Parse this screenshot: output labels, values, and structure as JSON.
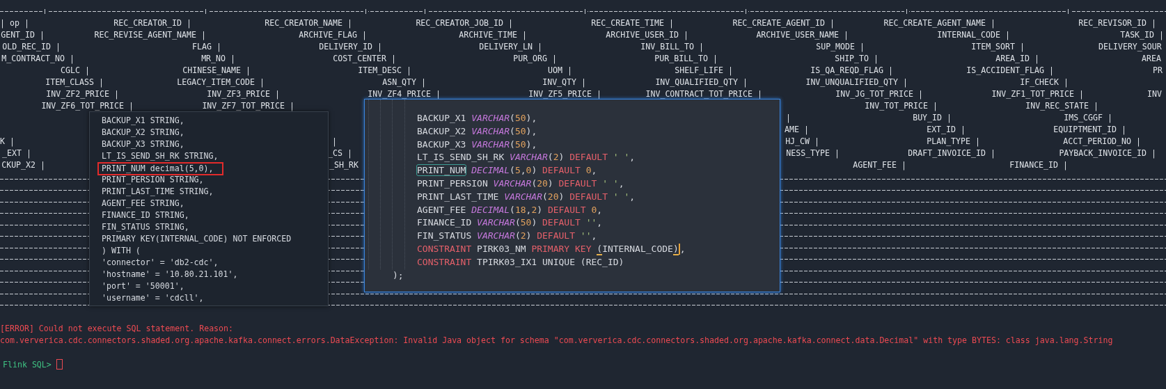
{
  "terminal": {
    "header_rows": [
      [
        "| op |",
        "REC_CREATOR_ID |",
        "REC_CREATOR_NAME |",
        "REC_CREATOR_JOB_ID |",
        "REC_CREATE_TIME |",
        "REC_CREATE_AGENT_ID |",
        "REC_CREATE_AGENT_NAME |",
        "REC_REVISOR_ID |"
      ],
      [
        "GENT_ID |",
        "REC_REVISE_AGENT_NAME |",
        "ARCHIVE_FLAG |",
        "ARCHIVE_TIME |",
        "ARCHIVE_USER_ID |",
        "ARCHIVE_USER_NAME |",
        "INTERNAL_CODE |",
        "TASK_ID |"
      ],
      [
        "OLD_REC_ID |",
        "FLAG |",
        "DELIVERY_ID |",
        "DELIVERY_LN |",
        "INV_BILL_TO |",
        "SUP_MODE |",
        "ITEM_SORT |",
        "DELIVERY_SOUR"
      ],
      [
        "M_CONTRACT_NO |",
        "MR_NO |",
        "COST_CENTER |",
        "PUR_ORG |",
        "PUR_BILL_TO |",
        "SHIP_TO |",
        "AREA_ID |",
        "AREA"
      ],
      [
        "CGLC |",
        "CHINESE_NAME |",
        "ITEM_DESC |",
        "UOM |",
        "SHELF_LIFE |",
        "IS_QA_REQD_FLAG |",
        "IS_ACCIDENT_FLAG |",
        "PR"
      ],
      [
        "ITEM_CLASS |",
        "LEGACY_ITEM_CODE |",
        "ASN_QTY |",
        "INV_QTY |",
        "INV_QUALIFIED_QTY |",
        "INV_UNQUALIFIED_QTY |",
        "IF_CHECK |"
      ],
      [
        "INV_ZF2_PRICE |",
        "INV_ZF3_PRICE |",
        "INV_ZF4_PRICE |",
        "INV_ZF5_PRICE |",
        "INV_CONTRACT_TOT_PRICE |",
        "INV_JG_TOT_PRICE |",
        "INV_ZF1_TOT_PRICE |",
        "INV"
      ],
      [
        "INV_ZF6_TOT_PRICE |",
        "INV_ZF7_TOT_PRICE |",
        "INV_TOT_PRICE |",
        "INV_REC_STATE |"
      ],
      [
        "|",
        "BUY_ID |",
        "IMS_CGGF |"
      ],
      [
        "AME |",
        "EXT_ID |",
        "EQUIPTMENT_ID |"
      ],
      [
        "K |",
        "|",
        "HJ_CW |",
        "PLAN_TYPE |",
        "ACCT_PERIOD_NO |"
      ],
      [
        "_EXT |",
        "_CS |",
        "NESS_TYPE |",
        "DRAFT_INVOICE_ID |",
        "PAYBACK_INVOICE_ID |"
      ],
      [
        "CKUP_X2 |",
        "_SH_RK",
        "AGENT_FEE |",
        "FINANCE_ID |"
      ]
    ],
    "error_lines": [
      "[ERROR] Could not execute SQL statement. Reason:",
      "com.ververica.cdc.connectors.shaded.org.apache.kafka.connect.errors.DataException: Invalid Java object for schema \"com.ververica.cdc.connectors.shaded.org.apache.kafka.connect.data.Decimal\" with type BYTES: class java.lang.String"
    ],
    "prompt": "Flink SQL>"
  },
  "left_snippet": {
    "lines": [
      {
        "text": "BACKUP_X1 STRING,",
        "highlighted": false
      },
      {
        "text": "BACKUP_X2 STRING,",
        "highlighted": false
      },
      {
        "text": "BACKUP_X3 STRING,",
        "highlighted": false
      },
      {
        "text": "LT_IS_SEND_SH_RK STRING,",
        "highlighted": false
      },
      {
        "text": "PRINT_NUM decimal(5,0),",
        "highlighted": true
      },
      {
        "text": "PRINT_PERSION STRING,",
        "highlighted": false
      },
      {
        "text": "PRINT_LAST_TIME STRING,",
        "highlighted": false
      },
      {
        "text": "AGENT_FEE STRING,",
        "highlighted": false
      },
      {
        "text": "FINANCE_ID STRING,",
        "highlighted": false
      },
      {
        "text": "FIN_STATUS STRING,",
        "highlighted": false
      },
      {
        "text": "PRIMARY KEY(INTERNAL_CODE) NOT ENFORCED",
        "highlighted": false
      },
      {
        "text": ") WITH (",
        "highlighted": false
      },
      {
        "text": "'connector' = 'db2-cdc',",
        "highlighted": false
      },
      {
        "text": "'hostname' = '10.80.21.101',",
        "highlighted": false
      },
      {
        "text": "'port' = '50001',",
        "highlighted": false
      },
      {
        "text": "'username' = 'cdcll',",
        "highlighted": false
      }
    ]
  },
  "right_snippet": {
    "lines": [
      {
        "tokens": [
          {
            "text": "BACKUP_X1 ",
            "kind": "plain"
          },
          {
            "text": "VARCHAR",
            "kind": "type"
          },
          {
            "text": "(",
            "kind": "plain"
          },
          {
            "text": "50",
            "kind": "num"
          },
          {
            "text": "),",
            "kind": "plain"
          }
        ]
      },
      {
        "tokens": [
          {
            "text": "BACKUP_X2 ",
            "kind": "plain"
          },
          {
            "text": "VARCHAR",
            "kind": "type"
          },
          {
            "text": "(",
            "kind": "plain"
          },
          {
            "text": "50",
            "kind": "num"
          },
          {
            "text": "),",
            "kind": "plain"
          }
        ]
      },
      {
        "tokens": [
          {
            "text": "BACKUP_X3 ",
            "kind": "plain"
          },
          {
            "text": "VARCHAR",
            "kind": "type"
          },
          {
            "text": "(",
            "kind": "plain"
          },
          {
            "text": "50",
            "kind": "num"
          },
          {
            "text": "),",
            "kind": "plain"
          }
        ]
      },
      {
        "tokens": [
          {
            "text": "LT_IS_SEND_SH_RK ",
            "kind": "plain"
          },
          {
            "text": "VARCHAR",
            "kind": "type"
          },
          {
            "text": "(",
            "kind": "plain"
          },
          {
            "text": "2",
            "kind": "num"
          },
          {
            "text": ") ",
            "kind": "plain"
          },
          {
            "text": "DEFAULT ",
            "kind": "kw"
          },
          {
            "text": "' '",
            "kind": "str"
          },
          {
            "text": ",",
            "kind": "plain"
          }
        ]
      },
      {
        "tokens": [
          {
            "text": "PRINT_NUM",
            "kind": "boxed"
          },
          {
            "text": " DECIMAL",
            "kind": "type"
          },
          {
            "text": "(",
            "kind": "plain"
          },
          {
            "text": "5",
            "kind": "num"
          },
          {
            "text": ",",
            "kind": "plain"
          },
          {
            "text": "0",
            "kind": "num"
          },
          {
            "text": ") ",
            "kind": "plain"
          },
          {
            "text": "DEFAULT ",
            "kind": "kw"
          },
          {
            "text": "0",
            "kind": "num"
          },
          {
            "text": ",",
            "kind": "plain"
          }
        ]
      },
      {
        "tokens": [
          {
            "text": "PRINT_PERSION ",
            "kind": "plain"
          },
          {
            "text": "VARCHAR",
            "kind": "type"
          },
          {
            "text": "(",
            "kind": "plain"
          },
          {
            "text": "20",
            "kind": "num"
          },
          {
            "text": ") ",
            "kind": "plain"
          },
          {
            "text": "DEFAULT ",
            "kind": "kw"
          },
          {
            "text": "' '",
            "kind": "str"
          },
          {
            "text": ",",
            "kind": "plain"
          }
        ]
      },
      {
        "tokens": [
          {
            "text": "PRINT_LAST_TIME ",
            "kind": "plain"
          },
          {
            "text": "VARCHAR",
            "kind": "type"
          },
          {
            "text": "(",
            "kind": "plain"
          },
          {
            "text": "20",
            "kind": "num"
          },
          {
            "text": ") ",
            "kind": "plain"
          },
          {
            "text": "DEFAULT ",
            "kind": "kw"
          },
          {
            "text": "' '",
            "kind": "str"
          },
          {
            "text": ",",
            "kind": "plain"
          }
        ]
      },
      {
        "tokens": [
          {
            "text": "AGENT_FEE ",
            "kind": "plain"
          },
          {
            "text": "DECIMAL",
            "kind": "type"
          },
          {
            "text": "(",
            "kind": "plain"
          },
          {
            "text": "18",
            "kind": "num"
          },
          {
            "text": ",",
            "kind": "plain"
          },
          {
            "text": "2",
            "kind": "num"
          },
          {
            "text": ") ",
            "kind": "plain"
          },
          {
            "text": "DEFAULT ",
            "kind": "kw"
          },
          {
            "text": "0",
            "kind": "num"
          },
          {
            "text": ",",
            "kind": "plain"
          }
        ]
      },
      {
        "tokens": [
          {
            "text": "FINANCE_ID ",
            "kind": "plain"
          },
          {
            "text": "VARCHAR",
            "kind": "type"
          },
          {
            "text": "(",
            "kind": "plain"
          },
          {
            "text": "50",
            "kind": "num"
          },
          {
            "text": ") ",
            "kind": "plain"
          },
          {
            "text": "DEFAULT ",
            "kind": "kw"
          },
          {
            "text": "''",
            "kind": "str"
          },
          {
            "text": ",",
            "kind": "plain"
          }
        ]
      },
      {
        "tokens": [
          {
            "text": "FIN_STATUS ",
            "kind": "plain"
          },
          {
            "text": "VARCHAR",
            "kind": "type"
          },
          {
            "text": "(",
            "kind": "plain"
          },
          {
            "text": "2",
            "kind": "num"
          },
          {
            "text": ") ",
            "kind": "plain"
          },
          {
            "text": "DEFAULT ",
            "kind": "kw"
          },
          {
            "text": "''",
            "kind": "str"
          },
          {
            "text": ",",
            "kind": "plain"
          }
        ]
      },
      {
        "tokens": [
          {
            "text": "CONSTRAINT ",
            "kind": "kw"
          },
          {
            "text": "PIRK03_NM ",
            "kind": "plain"
          },
          {
            "text": "PRIMARY KEY ",
            "kind": "kw"
          },
          {
            "text": "(",
            "kind": "match"
          },
          {
            "text": "INTERNAL_CODE",
            "kind": "plain"
          },
          {
            "text": ")",
            "kind": "match"
          },
          {
            "kind": "cursor"
          },
          {
            "text": ",",
            "kind": "plain"
          }
        ]
      },
      {
        "tokens": [
          {
            "text": "CONSTRAINT ",
            "kind": "kw"
          },
          {
            "text": "TPIRK03_IX1 UNIQUE (REC_ID)",
            "kind": "plain"
          }
        ]
      },
      {
        "tokens": [
          {
            "text": ");",
            "kind": "plain"
          }
        ]
      }
    ]
  }
}
